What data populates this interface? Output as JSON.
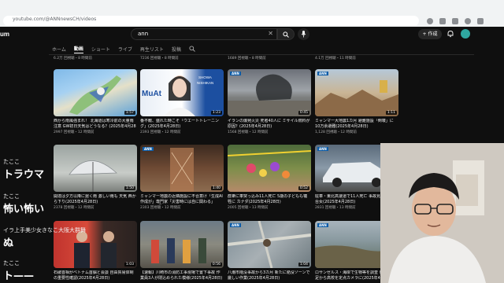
{
  "browser": {
    "url": "youtube.com/@ANNnewsCH/videos"
  },
  "youtube": {
    "logo": "um",
    "search_query": "ann",
    "create_label": "+ 作成"
  },
  "tabs": [
    {
      "label": "ホーム"
    },
    {
      "label": "動画"
    },
    {
      "label": "ショート"
    },
    {
      "label": "ライブ"
    },
    {
      "label": "再生リスト"
    },
    {
      "label": "投稿"
    }
  ],
  "top_row_meta": [
    "6.2万 回視聴・8 時間前",
    "7236 回視聴・8 時間前",
    "1689 回視聴・8 時間前",
    "4.1万 回視聴・11 時間前"
  ],
  "videos": [
    {
      "title": "西から南風強まれ！ 北海道は寒冷前の大量雨注意 GW初日天気はどうなる？(2025年4月28日)",
      "meta": "2997 回視聴・12 時間前",
      "duration": "1:57"
    },
    {
      "title": "番不敵、盛れた時こそ「ウエートトレーニング」(2025年4月28日)",
      "meta": "2393 回視聴・12 時間前",
      "duration": "1:23"
    },
    {
      "title": "イランの爆発火災 死者40人に ミサイル燃料が原因？(2025年4月28日)",
      "meta": "1568 回視聴・12 時間前",
      "duration": "0:45"
    },
    {
      "title": "ミャンマー大地震1カ月 避難施設「倒壊」に10万余避難(2025年4月28日)",
      "meta": "1,128 回視聴・12 時間前",
      "duration": "1:11"
    },
    {
      "title": "開達は夕方以降に遅く雨 激しい雨も 天気 西から下り(2025年4月28日)",
      "meta": "2378 回視聴・12 時間前",
      "duration": "1:50"
    },
    {
      "title": "ミャンマー地震の近隣施設に不合意け「生成AI作成が」専門家「災害時には自に関わる」(2025年4月28日)",
      "meta": "2303 回視聴・12 時間前",
      "duration": "1:40"
    },
    {
      "title": "群衆に車突っ込み11人死亡 5歳の子どもも犠牲に カナダ(2025年4月28日)",
      "meta": "2005 回視聴・13 時間前",
      "duration": "0:52"
    },
    {
      "title": "駐車・東北高速道で11人死亡 事故見た40代初台女(2025年4月28日)",
      "meta": "2831 回視聴・13 時間前",
      "duration": "1:00"
    },
    {
      "title": "石破首相がベトナム首脳と会談 自由貿易体制の重要性確認(2025年4月28日)",
      "meta": "",
      "duration": "1:03"
    },
    {
      "title": "【速報】川崎市の消防工事現場で置下事故 作業員3人が閉込められた模様(2025年4月28日)",
      "meta": "",
      "duration": "0:56"
    },
    {
      "title": "八潮市陥没事故から3カ月 新たに陥没ゾーンで厳しい作業(2025年4月28日)",
      "meta": "",
      "duration": "1:04"
    },
    {
      "title": "ロサンゼルス・海岸で生物等を調査 後継者不足から高校を定点カメラに(2025年4月28日)",
      "meta": "",
      "duration": "1:31"
    }
  ],
  "comments": [
    {
      "name": "たここ",
      "text": "トラウマ"
    },
    {
      "name": "たここ",
      "text": "怖い怖い"
    },
    {
      "name": "イラ上手美少女きなこ大阪大群舞",
      "text": "ぬ"
    },
    {
      "name": "たここ",
      "text": "ト——"
    }
  ],
  "colors": {
    "background": "#0f0f0f",
    "chrome": "#f1f3f4",
    "text": "#f1f1f1",
    "meta": "#aaaaaa",
    "ann_badge": "#0c5ca8"
  }
}
